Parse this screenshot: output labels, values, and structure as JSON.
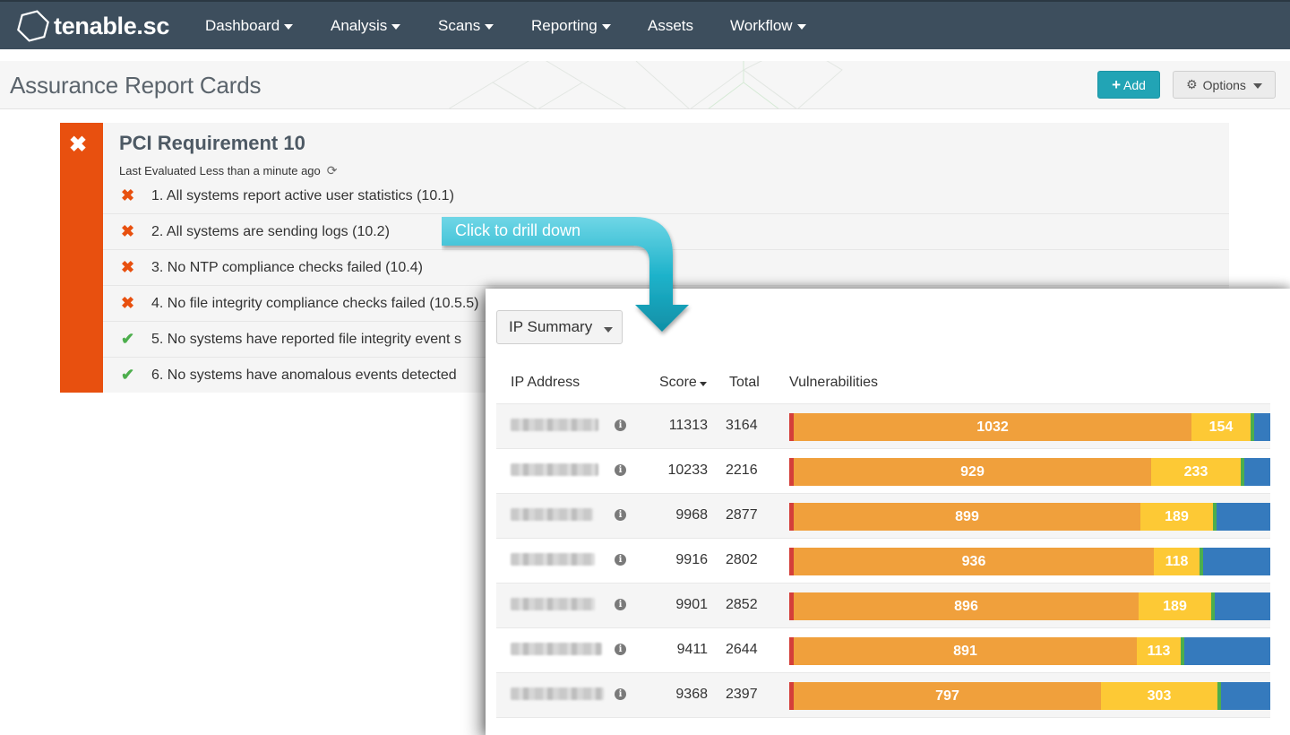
{
  "nav": {
    "logo_text": "tenable.sc",
    "items": [
      {
        "label": "Dashboard",
        "has_caret": true
      },
      {
        "label": "Analysis",
        "has_caret": true
      },
      {
        "label": "Scans",
        "has_caret": true
      },
      {
        "label": "Reporting",
        "has_caret": true
      },
      {
        "label": "Assets",
        "has_caret": false
      },
      {
        "label": "Workflow",
        "has_caret": true
      }
    ]
  },
  "header": {
    "title": "Assurance Report Cards",
    "add_label": "Add",
    "options_label": "Options"
  },
  "card": {
    "status": "fail",
    "title": "PCI Requirement 10",
    "last_evaluated": "Last Evaluated Less than a minute ago",
    "requirements": [
      {
        "text": "1. All systems report active user statistics (10.1)",
        "status": "fail"
      },
      {
        "text": "2. All systems are sending logs (10.2)",
        "status": "fail"
      },
      {
        "text": "3. No NTP compliance checks failed (10.4)",
        "status": "fail"
      },
      {
        "text": "4. No file integrity compliance checks failed (10.5.5)",
        "status": "fail"
      },
      {
        "text": "5. No systems have reported file integrity event s",
        "status": "pass"
      },
      {
        "text": "6. No systems have anomalous events detected",
        "status": "pass"
      }
    ]
  },
  "callout": {
    "text": "Click to drill down"
  },
  "panel": {
    "tool_label": "IP Summary",
    "columns": {
      "ip": "IP Address",
      "score": "Score",
      "total": "Total",
      "vulns": "Vulnerabilities"
    },
    "rows": [
      {
        "score": "11313",
        "total": "3164",
        "critical": 3,
        "high": "1032",
        "medium": "154"
      },
      {
        "score": "10233",
        "total": "2216",
        "critical": 3,
        "high": "929",
        "medium": "233"
      },
      {
        "score": "9968",
        "total": "2877",
        "critical": 3,
        "high": "899",
        "medium": "189"
      },
      {
        "score": "9916",
        "total": "2802",
        "critical": 3,
        "high": "936",
        "medium": "118"
      },
      {
        "score": "9901",
        "total": "2852",
        "critical": 3,
        "high": "896",
        "medium": "189"
      },
      {
        "score": "9411",
        "total": "2644",
        "critical": 3,
        "high": "891",
        "medium": "113"
      },
      {
        "score": "9368",
        "total": "2397",
        "critical": 3,
        "high": "797",
        "medium": "303"
      }
    ]
  },
  "colors": {
    "nav_bg": "#3d4e5d",
    "accent": "#22a4b5",
    "fail": "#e8500f",
    "pass": "#4cae4c",
    "critical": "#d43f3a",
    "high": "#f0a03c",
    "medium": "#fdc935",
    "low": "#4cae4c",
    "info": "#357abd"
  }
}
